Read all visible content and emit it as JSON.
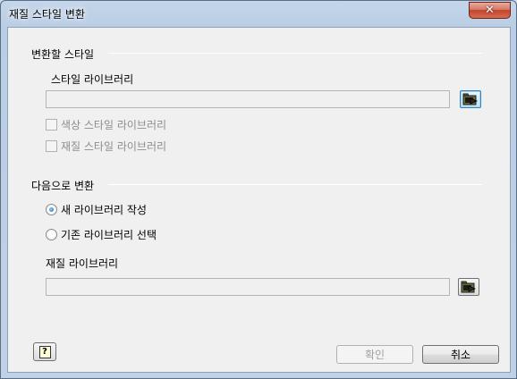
{
  "window": {
    "title": "재질 스타일 변환",
    "close_glyph": "✕"
  },
  "convert_styles": {
    "group_label": "변환할 스타일",
    "library_label": "스타일 라이브러리",
    "library_value": "",
    "options": [
      {
        "label": "색상 스타일 라이브러리",
        "checked": false,
        "enabled": false
      },
      {
        "label": "재질 스타일 라이브러리",
        "checked": false,
        "enabled": false
      }
    ]
  },
  "convert_to": {
    "group_label": "다음으로 변환",
    "radios": [
      {
        "label": "새 라이브러리 작성",
        "checked": true
      },
      {
        "label": "기존 라이브러리 선택",
        "checked": false
      }
    ],
    "material_library_label": "재질 라이브러리",
    "material_library_value": ""
  },
  "footer": {
    "help_glyph": "?",
    "ok_label": "확인",
    "ok_enabled": false,
    "cancel_label": "취소"
  },
  "icons": {
    "browse": "folder-browse-icon",
    "help": "help-icon"
  }
}
